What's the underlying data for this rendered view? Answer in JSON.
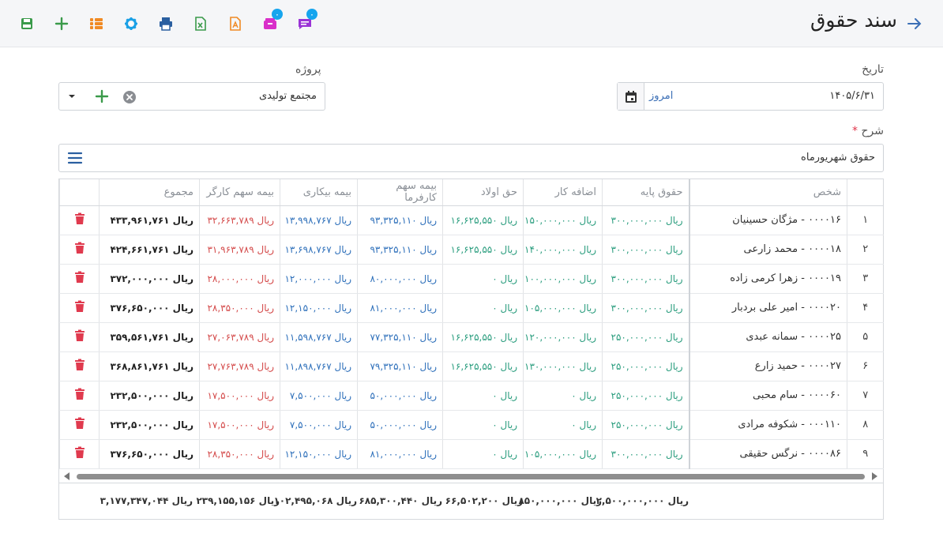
{
  "header": {
    "title": "سند حقوق",
    "notifications_badge": "۰",
    "messages_badge": "۰"
  },
  "form": {
    "date_label": "تاریخ",
    "date_value": "۱۴۰۵/۶/۳۱",
    "today_label": "امروز",
    "project_label": "پروژه",
    "project_value": "مجتمع تولیدی",
    "description_label": "شرح",
    "required_mark": "*",
    "description_value": "حقوق شهریورماه"
  },
  "table": {
    "headers": {
      "person": "شخص",
      "base_salary": "حقوق پایه",
      "overtime": "اضافه کار",
      "child_allowance": "حق اولاد",
      "employer_insurance": "بیمه سهم کارفرما",
      "unemployment_insurance": "بیمه بیکاری",
      "worker_insurance": "بیمه سهم کارگر",
      "total": "مجموع"
    },
    "rows": [
      {
        "idx": "۱",
        "person": "۰۰۰۰۱۶ - مژگان حسینیان",
        "base": "ریال ۳۰۰,۰۰۰,۰۰۰",
        "overtime": "ریال ۱۵۰,۰۰۰,۰۰۰",
        "child": "ریال ۱۶,۶۲۵,۵۵۰",
        "employer": "ریال ۹۳,۳۲۵,۱۱۰",
        "unemp": "ریال ۱۳,۹۹۸,۷۶۷",
        "worker": "ریال ۳۲,۶۶۳,۷۸۹",
        "total": "ریال ۴۳۳,۹۶۱,۷۶۱"
      },
      {
        "idx": "۲",
        "person": "۰۰۰۰۱۸ - محمد زارعی",
        "base": "ریال ۳۰۰,۰۰۰,۰۰۰",
        "overtime": "ریال ۱۴۰,۰۰۰,۰۰۰",
        "child": "ریال ۱۶,۶۲۵,۵۵۰",
        "employer": "ریال ۹۳,۳۲۵,۱۱۰",
        "unemp": "ریال ۱۳,۶۹۸,۷۶۷",
        "worker": "ریال ۳۱,۹۶۳,۷۸۹",
        "total": "ریال ۴۲۴,۶۶۱,۷۶۱"
      },
      {
        "idx": "۳",
        "person": "۰۰۰۰۱۹ - زهرا کرمی زاده",
        "base": "ریال ۳۰۰,۰۰۰,۰۰۰",
        "overtime": "ریال ۱۰۰,۰۰۰,۰۰۰",
        "child": "ریال ۰",
        "employer": "ریال ۸۰,۰۰۰,۰۰۰",
        "unemp": "ریال ۱۲,۰۰۰,۰۰۰",
        "worker": "ریال ۲۸,۰۰۰,۰۰۰",
        "total": "ریال ۳۷۲,۰۰۰,۰۰۰"
      },
      {
        "idx": "۴",
        "person": "۰۰۰۰۲۰ - امیر علی بردبار",
        "base": "ریال ۳۰۰,۰۰۰,۰۰۰",
        "overtime": "ریال ۱۰۵,۰۰۰,۰۰۰",
        "child": "ریال ۰",
        "employer": "ریال ۸۱,۰۰۰,۰۰۰",
        "unemp": "ریال ۱۲,۱۵۰,۰۰۰",
        "worker": "ریال ۲۸,۳۵۰,۰۰۰",
        "total": "ریال ۳۷۶,۶۵۰,۰۰۰"
      },
      {
        "idx": "۵",
        "person": "۰۰۰۰۲۵ - سمانه عبدی",
        "base": "ریال ۲۵۰,۰۰۰,۰۰۰",
        "overtime": "ریال ۱۲۰,۰۰۰,۰۰۰",
        "child": "ریال ۱۶,۶۲۵,۵۵۰",
        "employer": "ریال ۷۷,۳۲۵,۱۱۰",
        "unemp": "ریال ۱۱,۵۹۸,۷۶۷",
        "worker": "ریال ۲۷,۰۶۳,۷۸۹",
        "total": "ریال ۳۵۹,۵۶۱,۷۶۱"
      },
      {
        "idx": "۶",
        "person": "۰۰۰۰۲۷ - حمید زارع",
        "base": "ریال ۲۵۰,۰۰۰,۰۰۰",
        "overtime": "ریال ۱۳۰,۰۰۰,۰۰۰",
        "child": "ریال ۱۶,۶۲۵,۵۵۰",
        "employer": "ریال ۷۹,۳۲۵,۱۱۰",
        "unemp": "ریال ۱۱,۸۹۸,۷۶۷",
        "worker": "ریال ۲۷,۷۶۳,۷۸۹",
        "total": "ریال ۳۶۸,۸۶۱,۷۶۱"
      },
      {
        "idx": "۷",
        "person": "۰۰۰۰۶۰ - سام محبی",
        "base": "ریال ۲۵۰,۰۰۰,۰۰۰",
        "overtime": "ریال ۰",
        "child": "ریال ۰",
        "employer": "ریال ۵۰,۰۰۰,۰۰۰",
        "unemp": "ریال ۷,۵۰۰,۰۰۰",
        "worker": "ریال ۱۷,۵۰۰,۰۰۰",
        "total": "ریال ۲۳۲,۵۰۰,۰۰۰"
      },
      {
        "idx": "۸",
        "person": "۰۰۰۱۱۰ - شکوفه مرادی",
        "base": "ریال ۲۵۰,۰۰۰,۰۰۰",
        "overtime": "ریال ۰",
        "child": "ریال ۰",
        "employer": "ریال ۵۰,۰۰۰,۰۰۰",
        "unemp": "ریال ۷,۵۰۰,۰۰۰",
        "worker": "ریال ۱۷,۵۰۰,۰۰۰",
        "total": "ریال ۲۳۲,۵۰۰,۰۰۰"
      },
      {
        "idx": "۹",
        "person": "۰۰۰۰۸۶ - نرگس حقیقی",
        "base": "ریال ۳۰۰,۰۰۰,۰۰۰",
        "overtime": "ریال ۱۰۵,۰۰۰,۰۰۰",
        "child": "ریال ۰",
        "employer": "ریال ۸۱,۰۰۰,۰۰۰",
        "unemp": "ریال ۱۲,۱۵۰,۰۰۰",
        "worker": "ریال ۲۸,۳۵۰,۰۰۰",
        "total": "ریال ۳۷۶,۶۵۰,۰۰۰"
      }
    ],
    "footer": {
      "base": "ریال ۲,۵۰۰,۰۰۰,۰۰۰",
      "overtime": "ریال ۸۵۰,۰۰۰,۰۰۰",
      "child": "ریال ۶۶,۵۰۲,۲۰۰",
      "employer": "ریال ۶۸۵,۳۰۰,۴۴۰",
      "unemp": "ریال ۱۰۲,۴۹۵,۰۶۸",
      "worker": "ریال ۲۳۹,۱۵۵,۱۵۶",
      "total": "ریال ۳,۱۷۷,۳۴۷,۰۴۴"
    }
  },
  "icons": {
    "back": "arrow-right-icon",
    "toolbar": [
      "save-icon",
      "plus-icon",
      "list-icon",
      "gear-icon",
      "print-icon",
      "excel-icon",
      "pdf-icon",
      "notification-icon",
      "message-icon"
    ]
  },
  "colors": {
    "green": "#2a9d7e",
    "blue": "#2d6fba",
    "red": "#d44a4a",
    "delete": "#e03a4e"
  }
}
